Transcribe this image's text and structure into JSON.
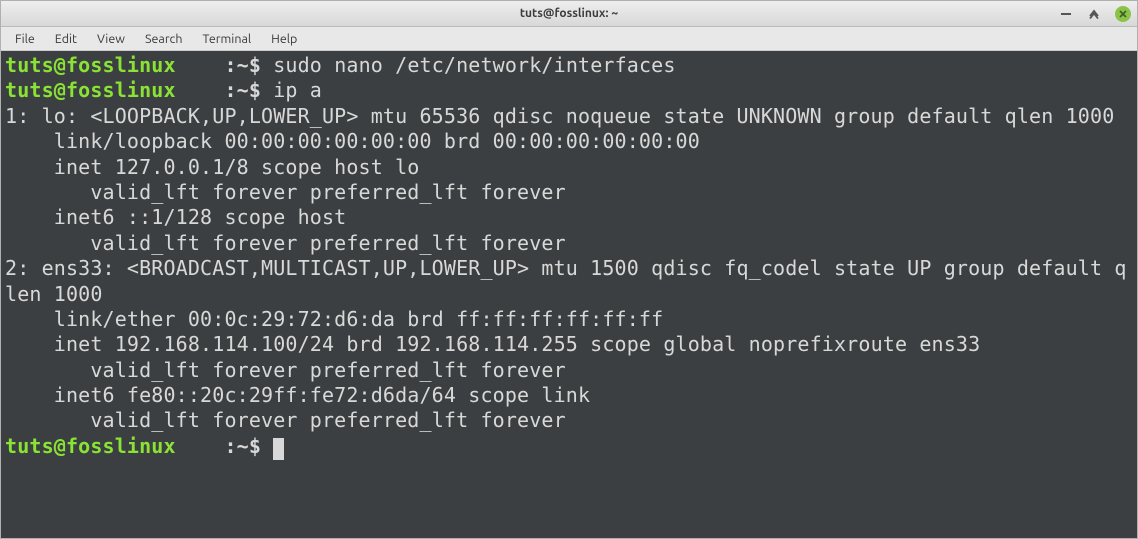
{
  "titlebar": {
    "title": "tuts@fosslinux: ~"
  },
  "menubar": {
    "items": [
      "File",
      "Edit",
      "View",
      "Search",
      "Terminal",
      "Help"
    ]
  },
  "terminal": {
    "prompt_user": "tuts@fosslinux",
    "prompt_sep": "    :",
    "prompt_tail": "~$ ",
    "commands": {
      "cmd1": "sudo nano /etc/network/interfaces",
      "cmd2": "ip a"
    },
    "output": [
      "1: lo: <LOOPBACK,UP,LOWER_UP> mtu 65536 qdisc noqueue state UNKNOWN group default qlen 1000",
      "    link/loopback 00:00:00:00:00:00 brd 00:00:00:00:00:00",
      "    inet 127.0.0.1/8 scope host lo",
      "       valid_lft forever preferred_lft forever",
      "    inet6 ::1/128 scope host",
      "       valid_lft forever preferred_lft forever",
      "2: ens33: <BROADCAST,MULTICAST,UP,LOWER_UP> mtu 1500 qdisc fq_codel state UP group default qlen 1000",
      "    link/ether 00:0c:29:72:d6:da brd ff:ff:ff:ff:ff:ff",
      "    inet 192.168.114.100/24 brd 192.168.114.255 scope global noprefixroute ens33",
      "       valid_lft forever preferred_lft forever",
      "    inet6 fe80::20c:29ff:fe72:d6da/64 scope link",
      "       valid_lft forever preferred_lft forever"
    ]
  }
}
